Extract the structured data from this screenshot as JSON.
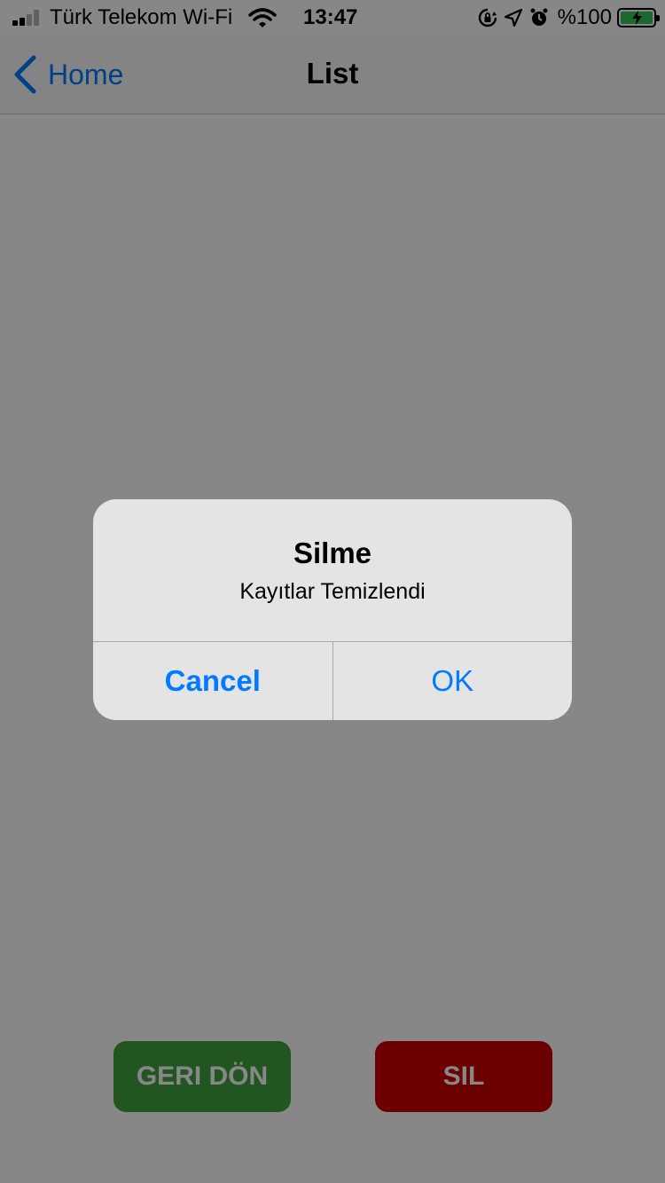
{
  "status_bar": {
    "carrier": "Türk Telekom Wi-Fi",
    "time": "13:47",
    "battery_percent": "%100",
    "icons": [
      "signal-icon",
      "wifi-icon",
      "orientation-lock-icon",
      "location-arrow-icon",
      "alarm-icon",
      "battery-charging-icon"
    ]
  },
  "nav": {
    "back_label": "Home",
    "title": "List"
  },
  "actions": {
    "back_label": "GERI DÖN",
    "delete_label": "SIL"
  },
  "alert": {
    "title": "Silme",
    "message": "Kayıtlar Temizlendi",
    "cancel_label": "Cancel",
    "ok_label": "OK"
  },
  "colors": {
    "accent": "#007aff",
    "back_button": "#3fa33f",
    "delete_button": "#cc0000",
    "battery": "#34c759"
  }
}
